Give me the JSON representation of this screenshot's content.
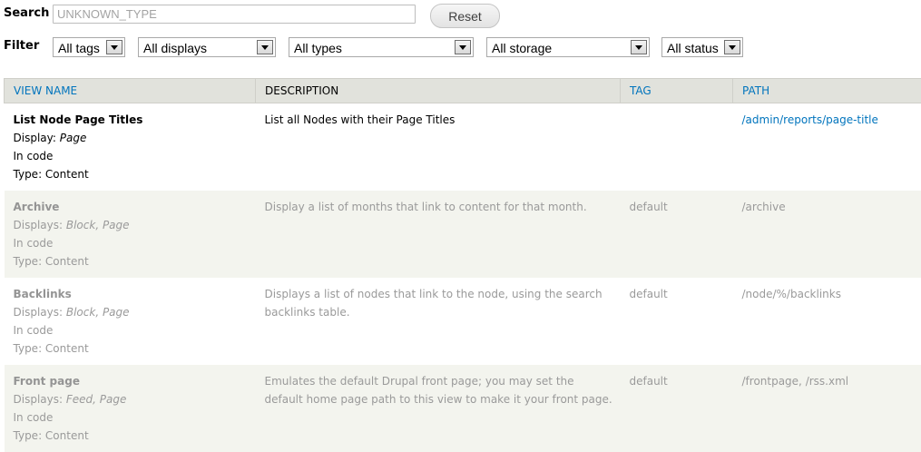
{
  "search": {
    "label": "Search",
    "placeholder": "UNKNOWN_TYPE",
    "value": "",
    "reset_label": "Reset"
  },
  "filter": {
    "label": "Filter",
    "tags": "All tags",
    "displays": "All displays",
    "types": "All types",
    "storage": "All storage",
    "status": "All status"
  },
  "table": {
    "headers": {
      "view_name": "VIEW NAME",
      "description": "DESCRIPTION",
      "tag": "TAG",
      "path": "PATH"
    },
    "rows": [
      {
        "name": "List Node Page Titles",
        "display_label": "Display:",
        "displays": "Page",
        "storage": "In code",
        "type": "Type: Content",
        "description": "List all Nodes with their Page Titles",
        "tag": "",
        "path": "/admin/reports/page-title",
        "enabled": true
      },
      {
        "name": "Archive",
        "display_label": "Displays:",
        "displays": "Block, Page",
        "storage": "In code",
        "type": "Type: Content",
        "description": "Display a list of months that link to content for that month.",
        "tag": "default",
        "path": "/archive",
        "enabled": false
      },
      {
        "name": "Backlinks",
        "display_label": "Displays:",
        "displays": "Block, Page",
        "storage": "In code",
        "type": "Type: Content",
        "description": "Displays a list of nodes that link to the node, using the search backlinks table.",
        "tag": "default",
        "path": "/node/%/backlinks",
        "enabled": false
      },
      {
        "name": "Front page",
        "display_label": "Displays:",
        "displays": "Feed, Page",
        "storage": "In code",
        "type": "Type: Content",
        "description": "Emulates the default Drupal front page; you may set the default home page path to this view to make it your front page.",
        "tag": "default",
        "path": "/frontpage, /rss.xml",
        "enabled": false
      }
    ]
  },
  "colors": {
    "link": "#0074bd",
    "header_bg": "#e1e2dc",
    "disabled_text": "#9a9a9a",
    "odd_row_bg": "#f3f4ee"
  }
}
